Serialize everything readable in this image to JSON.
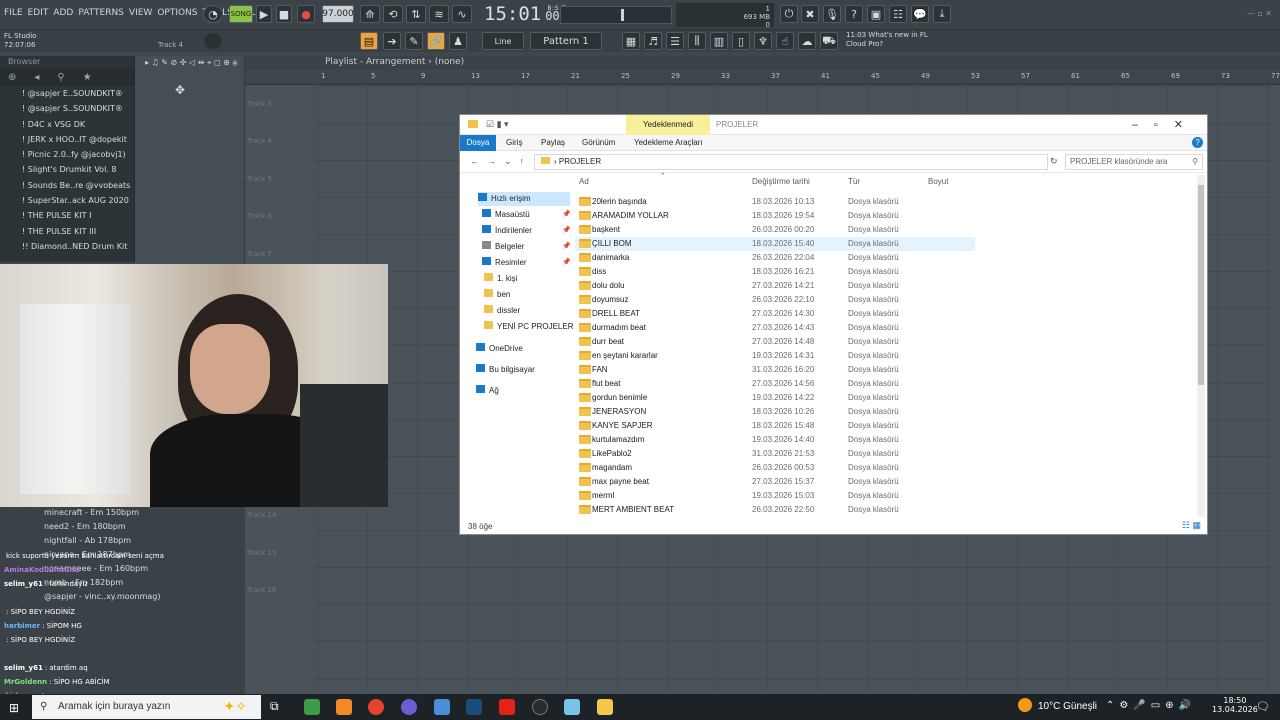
{
  "fl": {
    "menu": [
      "FILE",
      "EDIT",
      "ADD",
      "PATTERNS",
      "VIEW",
      "OPTIONS",
      "TOOLS",
      "HELP"
    ],
    "song_label": "SONG",
    "tempo": "97.000",
    "time_main": "15:01",
    "time_sub": "00",
    "time_tag": "B:S:T",
    "pattern": "Pattern 1",
    "line_mode": "Line",
    "hint_time": "11:03",
    "hint_text": "What's new in FL",
    "hint_text2": "Cloud Pro?",
    "app_name": "FL Studio",
    "app_time": "72:07:06",
    "track_label": "Track 4",
    "cpu": "1",
    "mem": "693 MB",
    "cpu_extra": "0",
    "browser_title": "Browser",
    "playlist_title": "Playlist - Arrangement",
    "playlist_sub": "(none)"
  },
  "browser": {
    "items": [
      "! @sapjer E..SOUNDKIT®",
      "! @sapjer S..SOUNDKIT®",
      "! D4C x VSG DK",
      "! JERK x HOO..IT @dopekit",
      "! Picnic 2.0..fy @jacobvj1)",
      "! Slight's Drumkit Vol. 8",
      "! Sounds Be..re @vvobeats",
      "! SuperStar..ack AUG 2020",
      "! THE PULSE KIT I",
      "! THE PULSE KIT III",
      "!! Diamond..NED Drum Kit"
    ]
  },
  "ruler": [
    "1",
    "5",
    "9",
    "13",
    "17",
    "21",
    "25",
    "29",
    "33",
    "37",
    "41",
    "45",
    "49",
    "53",
    "57",
    "61",
    "65",
    "69",
    "73",
    "77"
  ],
  "tracks": [
    "Track 3",
    "Track 4",
    "Track 5",
    "Track 6",
    "Track 7",
    "Track 8",
    "Track 9",
    "Track 10",
    "Track 11",
    "Track 12",
    "Track 13",
    "Track 14",
    "Track 15",
    "Track 16"
  ],
  "lower_list": [
    "minecraft - Em 150bpm",
    "need2 - Em 180bpm",
    "nightfall - Ab 178bpm",
    "nirvana - Em 187bpm",
    "nonameeee - Em 160bpm",
    "numb - Fm 182bpm",
    "@sapjer - vinc..xy.moonmag)"
  ],
  "chat": [
    {
      "user": "",
      "msg": "kick suporta yezarım banlattırcam seni açma"
    },
    {
      "user": "AminaKoduumtunu",
      "msg": ""
    },
    {
      "user": "selim_y61",
      "msg": ": farkındayız"
    },
    {
      "user": "",
      "msg": ""
    },
    {
      "user": "",
      "msg": ": SİPO BEY HGDİNİZ"
    },
    {
      "user": "harbimer",
      "msg": ": SİPOM HG"
    },
    {
      "user": "",
      "msg": ": SİPO BEY HGDİNİZ"
    },
    {
      "user": "",
      "msg": ""
    },
    {
      "user": "selim_y61",
      "msg": ": atardim aq"
    },
    {
      "user": "MrGoldenn",
      "msg": ": SİPO HG ABİCİM"
    },
    {
      "user": "",
      "msg": "kick suporta yazarım"
    }
  ],
  "explorer": {
    "context_tab": "Yedeklenmedi",
    "title": "PROJELER",
    "tabs": [
      "Dosya",
      "Giriş",
      "Paylaş",
      "Görünüm"
    ],
    "context_sub": "Yedekleme Araçları",
    "breadcrumb": "PROJELER",
    "search_placeholder": "PROJELER klasöründe ara",
    "cols": [
      "Ad",
      "Değiştirme tarihi",
      "Tür",
      "Boyut"
    ],
    "nav": [
      {
        "label": "Hızlı erişim",
        "pin": false
      },
      {
        "label": "Masaüstü",
        "pin": true
      },
      {
        "label": "İndirilenler",
        "pin": true
      },
      {
        "label": "Belgeler",
        "pin": true
      },
      {
        "label": "Resimler",
        "pin": true
      },
      {
        "label": "1. kişi",
        "pin": false
      },
      {
        "label": "ben",
        "pin": false
      },
      {
        "label": "dissler",
        "pin": false
      },
      {
        "label": "YENİ PC PROJELER",
        "pin": false
      },
      {
        "label": "OneDrive",
        "pin": false
      },
      {
        "label": "Bu bilgisayar",
        "pin": false
      },
      {
        "label": "Ağ",
        "pin": false
      }
    ],
    "files": [
      {
        "name": "20lerin başında",
        "date": "18.03.2026 10:13",
        "type": "Dosya klasörü"
      },
      {
        "name": "ARAMADIM YOLLAR",
        "date": "18.03.2026 19:54",
        "type": "Dosya klasörü"
      },
      {
        "name": "başkent",
        "date": "26.03.2026 00:20",
        "type": "Dosya klasörü"
      },
      {
        "name": "ÇILLI BOM",
        "date": "18.03.2026 15:40",
        "type": "Dosya klasörü"
      },
      {
        "name": "danimarka",
        "date": "26.03.2026 22:04",
        "type": "Dosya klasörü"
      },
      {
        "name": "diss",
        "date": "18.03.2026 16:21",
        "type": "Dosya klasörü"
      },
      {
        "name": "dolu dolu",
        "date": "27.03.2026 14:21",
        "type": "Dosya klasörü"
      },
      {
        "name": "doyumsuz",
        "date": "26.03.2026 22:10",
        "type": "Dosya klasörü"
      },
      {
        "name": "DRELL BEAT",
        "date": "27.03.2026 14:30",
        "type": "Dosya klasörü"
      },
      {
        "name": "durmadım beat",
        "date": "27.03.2026 14:43",
        "type": "Dosya klasörü"
      },
      {
        "name": "durr beat",
        "date": "27.03.2026 14:48",
        "type": "Dosya klasörü"
      },
      {
        "name": "en şeytani kararlar",
        "date": "19.03.2026 14:31",
        "type": "Dosya klasörü"
      },
      {
        "name": "FAN",
        "date": "31.03.2026 16:20",
        "type": "Dosya klasörü"
      },
      {
        "name": "flut beat",
        "date": "27.03.2026 14:56",
        "type": "Dosya klasörü"
      },
      {
        "name": "gordun benimle",
        "date": "19.03.2026 14:22",
        "type": "Dosya klasörü"
      },
      {
        "name": "JENERASYON",
        "date": "18.03.2026 10:26",
        "type": "Dosya klasörü"
      },
      {
        "name": "KANYE SAPJER",
        "date": "18.03.2026 15:48",
        "type": "Dosya klasörü"
      },
      {
        "name": "kurtulamazdım",
        "date": "19.03.2026 14:40",
        "type": "Dosya klasörü"
      },
      {
        "name": "LikePablo2",
        "date": "31.03.2026 21:53",
        "type": "Dosya klasörü"
      },
      {
        "name": "magandam",
        "date": "26.03.2026 00:53",
        "type": "Dosya klasörü"
      },
      {
        "name": "max payne beat",
        "date": "27.03.2026 15:37",
        "type": "Dosya klasörü"
      },
      {
        "name": "merml",
        "date": "19.03.2026 15:03",
        "type": "Dosya klasörü"
      },
      {
        "name": "MERT AMBIENT BEAT",
        "date": "26.03.2026 22:50",
        "type": "Dosya klasörü"
      }
    ],
    "status": "38 öğe"
  },
  "taskbar": {
    "search": "Aramak için buraya yazın",
    "weather": "10°C  Güneşli",
    "time": "18:50",
    "date": "13.04.2026"
  }
}
